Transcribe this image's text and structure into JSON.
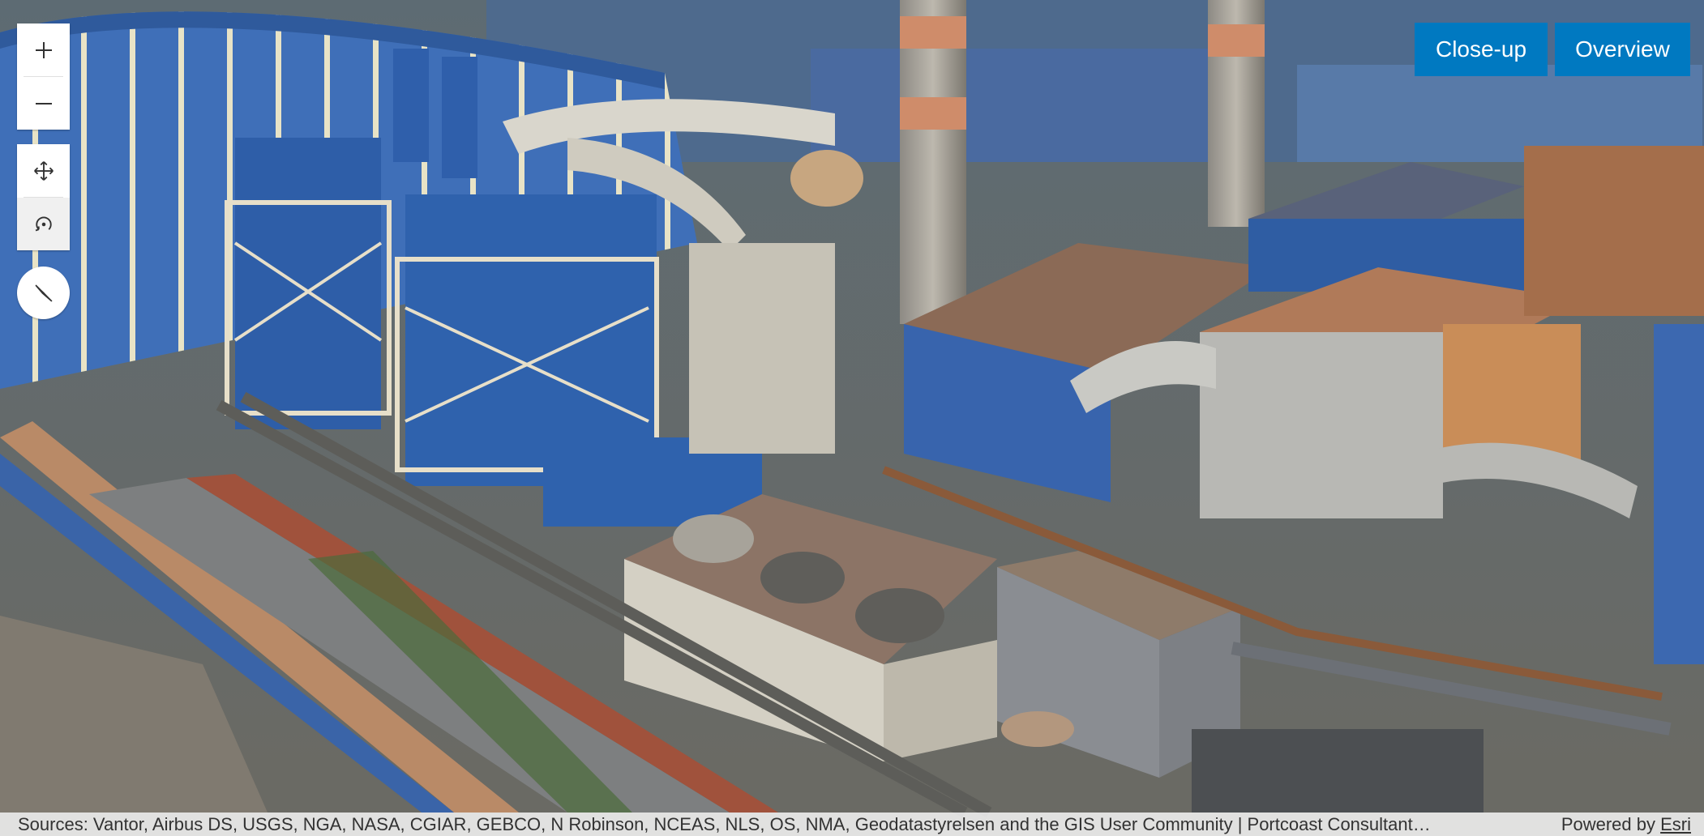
{
  "map": {
    "zoom_in_icon": "plus-icon",
    "zoom_out_icon": "minus-icon",
    "pan_icon": "move-arrows-icon",
    "rotate_icon": "rotate-icon",
    "compass_icon": "compass-needle-icon"
  },
  "view_buttons": {
    "closeup": "Close-up",
    "overview": "Overview"
  },
  "attribution": {
    "sources": "Sources: Vantor, Airbus DS, USGS, NGA, NASA, CGIAR, GEBCO, N Robinson, NCEAS, NLS, OS, NMA, Geodatastyrelsen and the GIS User Community | Portcoast Consultant…",
    "powered_prefix": "Powered by",
    "powered_link": "Esri"
  },
  "colors": {
    "accent": "#0079c1",
    "roof_blue": "#3b69b0",
    "rust": "#b77a4e"
  }
}
